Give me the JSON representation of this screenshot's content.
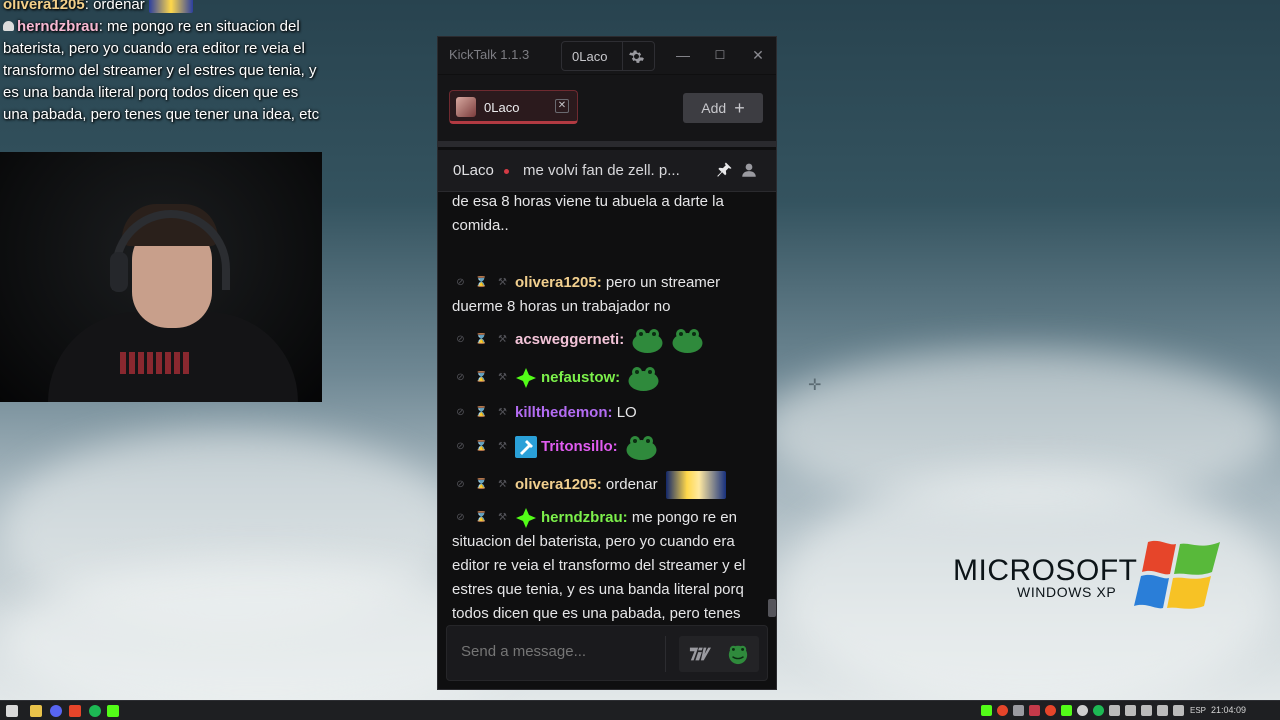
{
  "overlay_chat": {
    "line1_user": "olivera1205",
    "line1_text": ": ordenar",
    "line2_user": "herndzbrau",
    "line2_text": ": me pongo re en situacion del baterista, pero yo cuando era editor re veia el transformo del streamer y el estres que tenia, y es una banda literal porq todos dicen que es una pabada, pero tenes que tener una idea, etc"
  },
  "window": {
    "app_title": "KickTalk 1.1.3",
    "user": "0Laco",
    "minimize": "—",
    "maximize": "☐",
    "close": "✕"
  },
  "tabs": [
    {
      "label": "0Laco",
      "close": "✕"
    }
  ],
  "add_button": {
    "label": "Add",
    "plus": "+"
  },
  "pinned": {
    "user": "0Laco",
    "text": "me volvi fan de zell. p..."
  },
  "messages": [
    {
      "user": "",
      "text": "de esa 8 horas viene tu abuela a darte la comida.."
    },
    {
      "user": "olivera1205:",
      "text": "pero un streamer duerme 8 horas un trabajador no"
    },
    {
      "user": "acsweggerneti:",
      "text": ""
    },
    {
      "user": "nefaustow:",
      "text": ""
    },
    {
      "user": "killthedemon:",
      "text": "LO"
    },
    {
      "user": "Tritonsillo:",
      "text": ""
    },
    {
      "user": "olivera1205:",
      "text": "ordenar"
    },
    {
      "user": "herndzbrau:",
      "text": "me pongo re en situacion del baterista, pero yo cuando era editor re veia el transformo del streamer y el estres que tenia, y es una banda literal porq todos dicen que es una pabada, pero tenes que tener una idea, etc"
    }
  ],
  "input": {
    "placeholder": "Send a message..."
  },
  "xp_logo": {
    "brand": "MICROSOFT",
    "product": "WINDOWS XP"
  },
  "taskbar": {
    "language": "ESP",
    "clock": "21:04:09"
  },
  "colors": {
    "accent_red": "#b23a42",
    "kick_green": "#53fc18",
    "username_yellow": "#f1cf8e",
    "username_pink": "#f3c4d8",
    "username_green": "#7cf04b",
    "username_purple": "#b36cf2",
    "username_magenta": "#e15cf1"
  }
}
